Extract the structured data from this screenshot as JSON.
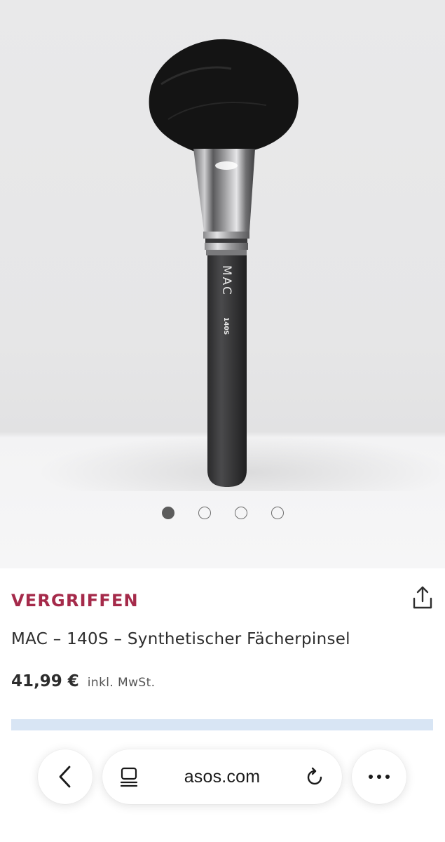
{
  "gallery": {
    "alt": "MAC 140S Synthetischer Fächerpinsel",
    "brush_text_brand": "MAC",
    "brush_text_model": "140S",
    "image_count": 4,
    "active_index": 0
  },
  "product": {
    "stock_status": "VERGRIFFEN",
    "title": "MAC – 140S – Synthetischer Fächerpinsel",
    "price": "41,99 €",
    "vat_note": "inkl. MwSt."
  },
  "browser": {
    "url": "asos.com"
  },
  "icons": {
    "share": "share-icon",
    "back": "chevron-left-icon",
    "tabs": "tab-overview-icon",
    "reload": "reload-icon",
    "more": "more-icon"
  },
  "colors": {
    "stock_status": "#a52a4a",
    "info_bar": "#d8e5f4",
    "text": "#2d2d2d"
  }
}
